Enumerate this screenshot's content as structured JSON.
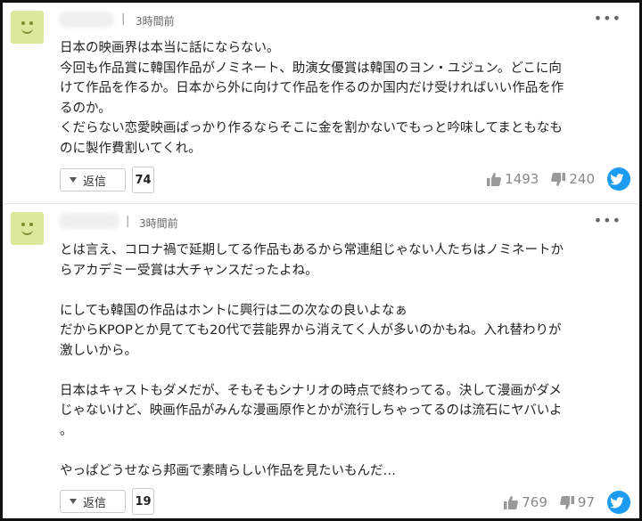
{
  "comments": [
    {
      "time": "3時間前",
      "lines": [
        "日本の映画界は本当に話にならない。",
        "今回も作品賞に韓国作品がノミネート、助演女優賞は韓国のヨン・ユジュン。どこに向",
        "けて作品を作るか。日本から外に向けて作品を作るのか国内だけ受ければいい作品を作",
        "るのか。",
        "くだらない恋愛映画ばっかり作るならそこに金を割かないでもっと吟味してまともなも",
        "のに製作費割いてくれ。"
      ],
      "reply_label": "返信",
      "reply_count": "74",
      "likes": "1493",
      "dislikes": "240"
    },
    {
      "time": "3時間前",
      "lines": [
        "とは言え、コロナ禍で延期してる作品もあるから常連組じゃない人たちはノミネートか",
        "らアカデミー受賞は大チャンスだったよね。",
        "",
        "にしても韓国の作品はホントに興行は二の次なの良いよなぁ",
        "だからKPOPとか見てても20代で芸能界から消えてく人が多いのかもね。入れ替わりが",
        "激しいから。",
        "",
        "日本はキャストもダメだが、そもそもシナリオの時点で終わってる。決して漫画がダメ",
        "じゃないけど、映画作品がみんな漫画原作とかが流行しちゃってるのは流石にヤバいよ",
        "。",
        "",
        "やっぱどうせなら邦画で素晴らしい作品を見たいもんだ…"
      ],
      "reply_label": "返信",
      "reply_count": "19",
      "likes": "769",
      "dislikes": "97"
    }
  ],
  "more_icon": "•••",
  "colors": {
    "twitter": "#1d9bf0",
    "avatar_bg": "#dce89a"
  }
}
